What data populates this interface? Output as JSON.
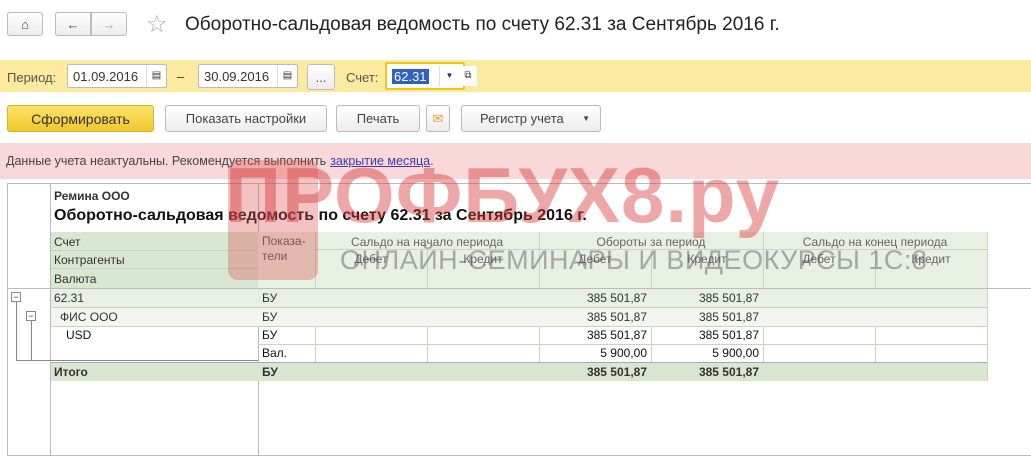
{
  "header": {
    "title": "Оборотно-сальдовая ведомость по счету 62.31 за Сентябрь 2016 г."
  },
  "toolbar": {
    "period_label": "Период:",
    "date_from": "01.09.2016",
    "dash": "–",
    "date_to": "30.09.2016",
    "more": "...",
    "account_label": "Счет:",
    "account_value": "62.31"
  },
  "actions": {
    "generate": "Сформировать",
    "show_settings": "Показать настройки",
    "print": "Печать",
    "register": "Регистр учета"
  },
  "warning": {
    "text": "Данные учета неактуальны. Рекомендуется выполнить",
    "link": "закрытие месяца",
    "end": "."
  },
  "report": {
    "org": "Ремина ООО",
    "title": "Оборотно-сальдовая ведомость по счету 62.31 за Сентябрь 2016 г.",
    "head": {
      "account": "Счет",
      "counterparty": "Контрагенты",
      "currency": "Валюта",
      "indicators": "Показа-\nтели",
      "open": "Сальдо на начало периода",
      "turnover": "Обороты за период",
      "close": "Сальдо на конец периода",
      "debit": "Дебет",
      "credit": "Кредит"
    },
    "rows": [
      {
        "name": "62.31",
        "ind": "БУ",
        "ob_d": "385 501,87",
        "ob_c": "385 501,87"
      },
      {
        "name": "ФИС ООО",
        "ind": "БУ",
        "ob_d": "385 501,87",
        "ob_c": "385 501,87"
      },
      {
        "name": "USD",
        "ind": "БУ",
        "ob_d": "385 501,87",
        "ob_c": "385 501,87"
      },
      {
        "name": "",
        "ind": "Вал.",
        "ob_d": "5 900,00",
        "ob_c": "5 900,00"
      }
    ],
    "total": {
      "name": "Итого",
      "ind": "БУ",
      "ob_d": "385 501,87",
      "ob_c": "385 501,87"
    }
  },
  "watermark": {
    "brand": "ПРОФБУХ8.ру",
    "tagline": "ОНЛАЙН-СЕМИНАРЫ И ВИДЕОКУРСЫ 1С:8"
  },
  "colors": {
    "accent_yellow": "#f5d234",
    "header_green": "#d9e7d2",
    "warning_bg": "#f8d8d8"
  }
}
